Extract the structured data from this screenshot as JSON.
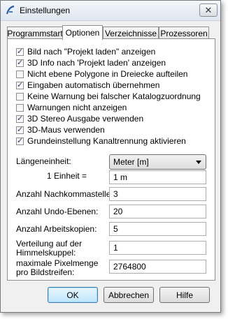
{
  "window": {
    "title": "Einstellungen"
  },
  "tabs": [
    {
      "label": "Programmstart"
    },
    {
      "label": "Optionen"
    },
    {
      "label": "Verzeichnisse"
    },
    {
      "label": "Prozessoren"
    }
  ],
  "options": [
    {
      "label": "Bild nach \"Projekt laden\" anzeigen",
      "checked": true
    },
    {
      "label": "3D Info nach 'Projekt laden' anzeigen",
      "checked": true
    },
    {
      "label": "Nicht ebene Polygone in Dreiecke aufteilen",
      "checked": false
    },
    {
      "label": "Eingaben automatisch übernehmen",
      "checked": true
    },
    {
      "label": "Keine Warnung bei falscher Katalogzuordnung",
      "checked": false
    },
    {
      "label": "Warnungen nicht anzeigen",
      "checked": false
    },
    {
      "label": "3D Stereo Ausgabe verwenden",
      "checked": true
    },
    {
      "label": "3D-Maus verwenden",
      "checked": true
    },
    {
      "label": "Grundeinstellung Kanaltrennung aktivieren",
      "checked": true
    }
  ],
  "fields": {
    "length_unit": {
      "label": "Längeneinheit:",
      "value": "Meter [m]"
    },
    "unit_equals": {
      "label": "1 Einheit =",
      "value": "1 m"
    },
    "decimals": {
      "label": "Anzahl Nachkommastellen:",
      "value": "3"
    },
    "undo_levels": {
      "label": "Anzahl Undo-Ebenen:",
      "value": "20"
    },
    "work_copies": {
      "label": "Anzahl Arbeitskopien:",
      "value": "5"
    },
    "sky_distribution": {
      "label_line1": "Verteilung auf der",
      "label_line2": "Himmelskuppel:",
      "value": "1"
    },
    "max_pixels": {
      "label_line1": "maximale Pixelmenge",
      "label_line2": "pro Bildstreifen:",
      "value": "2764800"
    }
  },
  "buttons": {
    "ok": "OK",
    "cancel": "Abbrechen",
    "help": "Hilfe"
  },
  "icons": {
    "app": "app-logo-icon",
    "close": "close-icon"
  }
}
